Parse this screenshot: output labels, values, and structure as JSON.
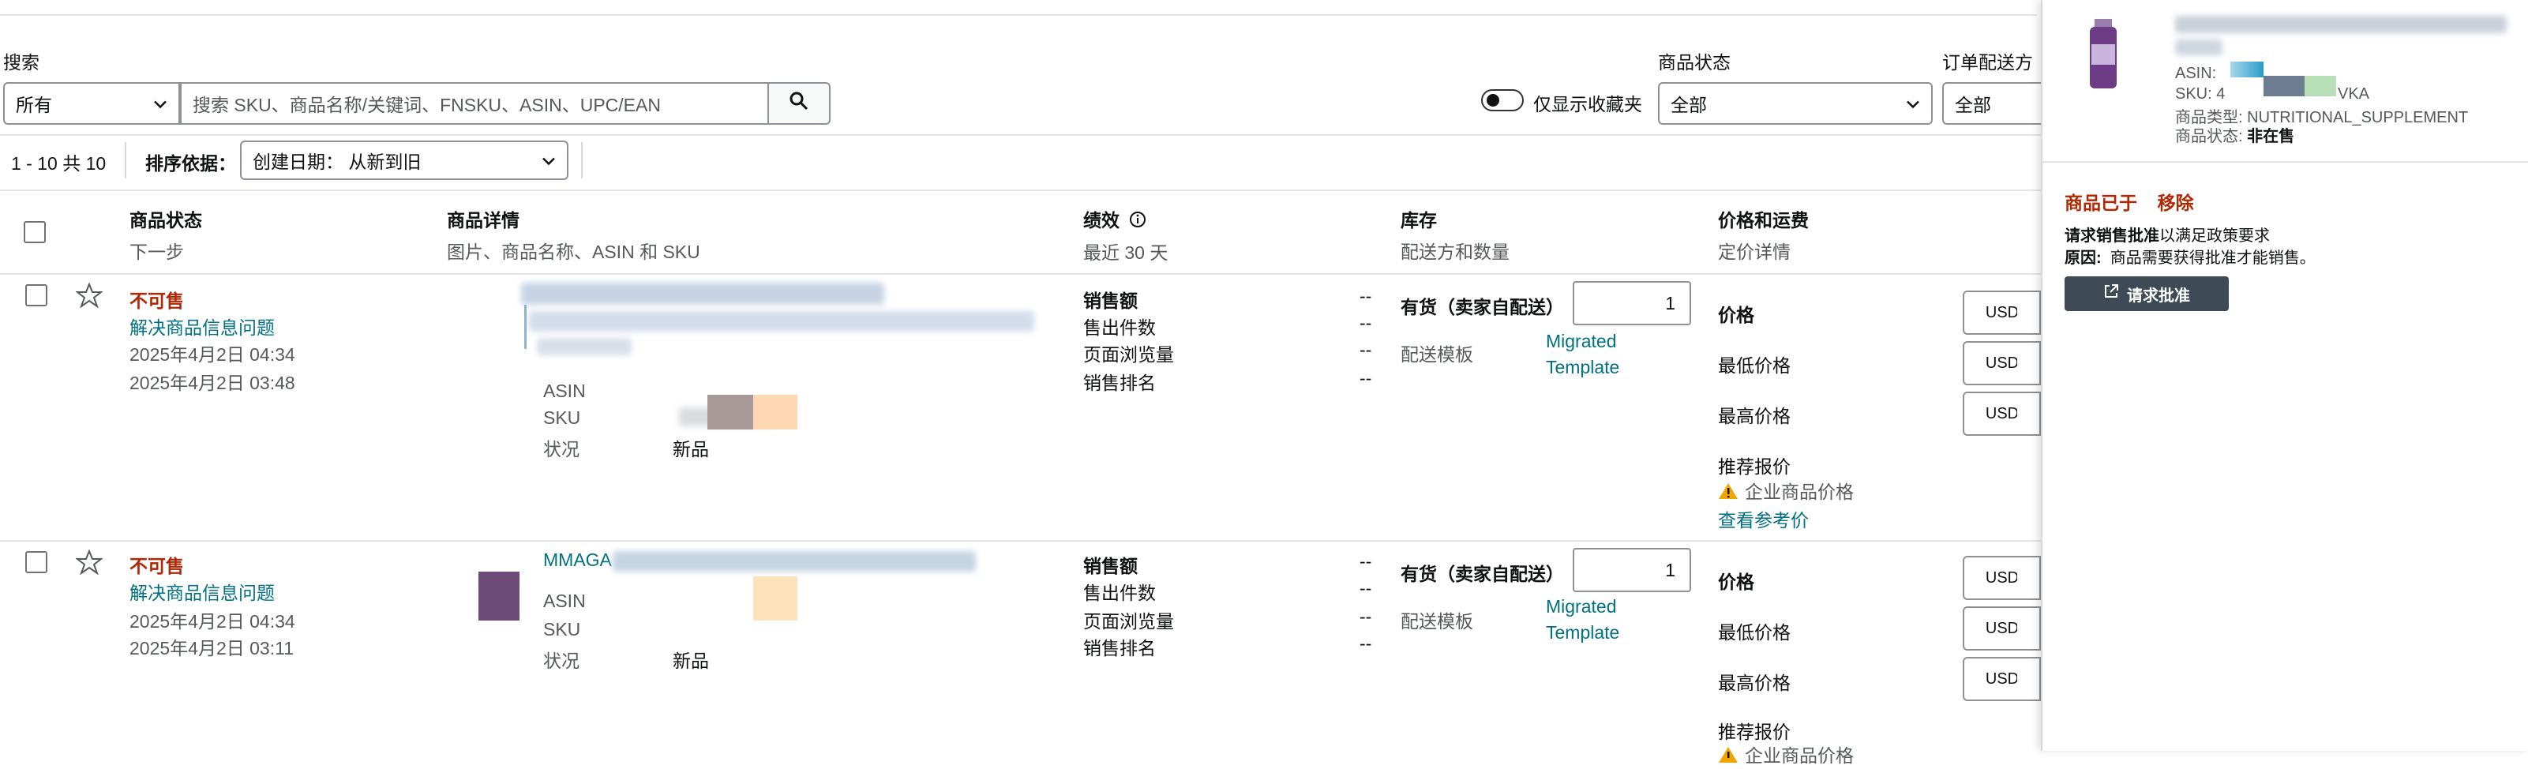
{
  "filters": {
    "search_label": "搜索",
    "search_scope": "所有",
    "search_placeholder": "搜索 SKU、商品名称/关键词、FNSKU、ASIN、UPC/EAN",
    "favorites_only": "仅显示收藏夹",
    "status_label": "商品状态",
    "status_value": "全部",
    "fulfillment_label": "订单配送方",
    "fulfillment_value": "全部"
  },
  "results": {
    "count": "1 - 10 共 10",
    "sort_label": "排序依据：",
    "sort_value": "创建日期：  从新到旧"
  },
  "columns": [
    {
      "title": "商品状态",
      "sub": "下一步"
    },
    {
      "title": "商品详情",
      "sub": "图片、商品名称、ASIN 和 SKU"
    },
    {
      "title": "绩效",
      "sub": "最近 30 天"
    },
    {
      "title": "库存",
      "sub": "配送方和数量"
    },
    {
      "title": "价格和运费",
      "sub": "定价详情"
    }
  ],
  "rows": [
    {
      "status": "不可售",
      "action": "解决商品信息问题",
      "created": "2025年4月2日 04:34",
      "updated": "2025年4月2日 03:48",
      "asin_label": "ASIN",
      "sku_label": "SKU",
      "condition_label": "状况",
      "condition_value": "新品",
      "perf_labels": [
        "销售额",
        "售出件数",
        "页面浏览量",
        "销售排名"
      ],
      "perf_values": [
        "--",
        "--",
        "--",
        "--"
      ],
      "inventory_title": "有货（卖家自配送）",
      "quantity": "1",
      "template_label": "配送模板",
      "template_value": "Migrated Template",
      "price_labels": [
        "价格",
        "最低价格",
        "最高价格"
      ],
      "currency": "USD",
      "recommended_label": "推荐报价",
      "business_price": "企业商品价格",
      "reference_link": "查看参考价"
    },
    {
      "status": "不可售",
      "action": "解决商品信息问题",
      "created": "2025年4月2日 04:34",
      "updated": "2025年4月2日 03:11",
      "title_fragment": "MMAGA",
      "asin_label": "ASIN",
      "sku_label": "SKU",
      "condition_label": "状况",
      "condition_value": "新品",
      "perf_labels": [
        "销售额",
        "售出件数",
        "页面浏览量",
        "销售排名"
      ],
      "perf_values": [
        "--",
        "--",
        "--",
        "--"
      ],
      "inventory_title": "有货（卖家自配送）",
      "quantity": "1",
      "template_label": "配送模板",
      "template_value": "Migrated Template",
      "price_labels": [
        "价格",
        "最低价格",
        "最高价格"
      ],
      "currency": "USD",
      "recommended_label": "推荐报价",
      "business_price": "企业商品价格"
    }
  ],
  "panel": {
    "asin_label": "ASIN:",
    "sku_label": "SKU:",
    "sku_partial_start": "4",
    "sku_partial_end": "VKA",
    "product_type_label": "商品类型:",
    "product_type_value": "NUTRITIONAL_SUPPLEMENT",
    "product_status_label": "商品状态:",
    "product_status_value": "非在售",
    "removed_prefix": "商品已于",
    "removed_word": "移除",
    "request_bold": "请求销售批准",
    "request_rest": "以满足政策要求",
    "reason_label": "原因:",
    "reason_text": "商品需要获得批准才能销售。",
    "approval_button": "请求批准"
  },
  "colors": {
    "alert_red": "#b12704",
    "link_teal": "#007185",
    "dark_button": "#3e4a55",
    "warning_yellow": "#f0a500"
  }
}
